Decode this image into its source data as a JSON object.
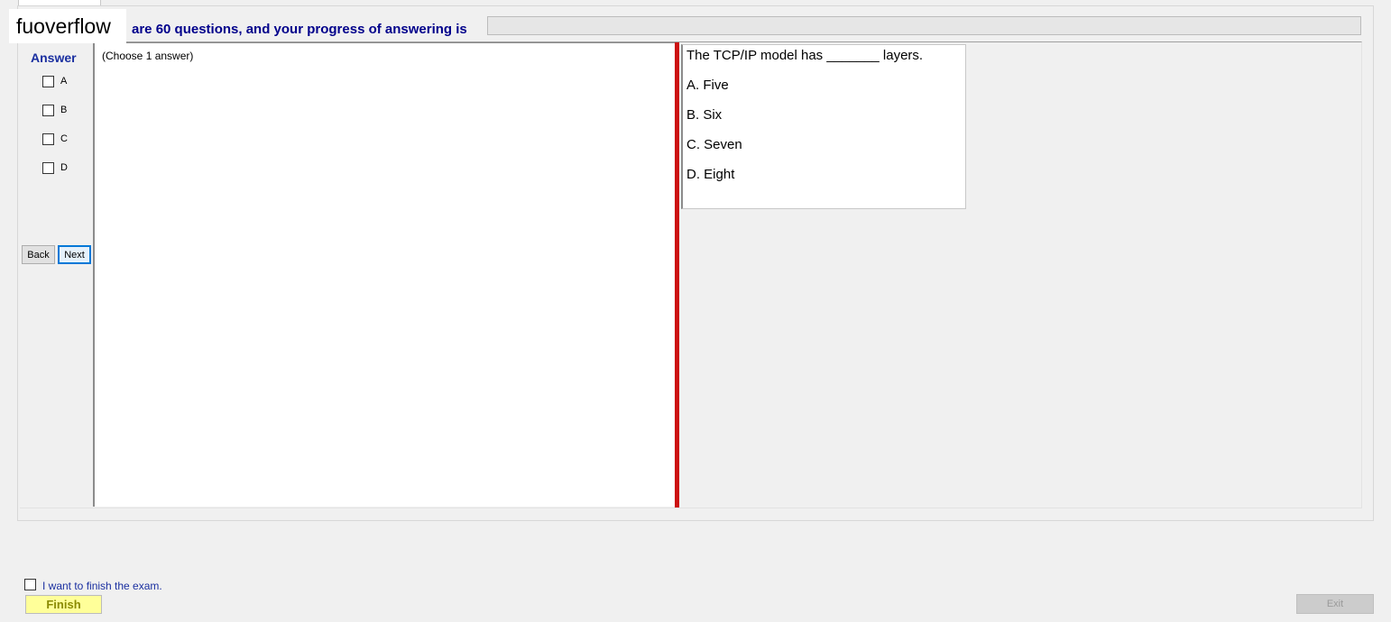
{
  "watermark": "fuoverflow",
  "header": {
    "progress_text": "are 60 questions, and your progress of answering is",
    "progress_fraction": 0
  },
  "answer_panel": {
    "title": "Answer",
    "options": [
      "A",
      "B",
      "C",
      "D"
    ],
    "back_label": "Back",
    "next_label": "Next"
  },
  "work_area": {
    "hint": "(Choose 1 answer)"
  },
  "question": {
    "text": "The TCP/IP model has _______ layers.",
    "choices": [
      "A.  Five",
      "B.  Six",
      "C.  Seven",
      "D.  Eight"
    ]
  },
  "footer": {
    "finish_checkbox_label": "I want to finish the exam.",
    "finish_label": "Finish",
    "exit_label": "Exit"
  },
  "colors": {
    "accent_blue": "#1a2fa0",
    "splitter_red": "#cc1111",
    "finish_yellow": "#ffff99"
  }
}
